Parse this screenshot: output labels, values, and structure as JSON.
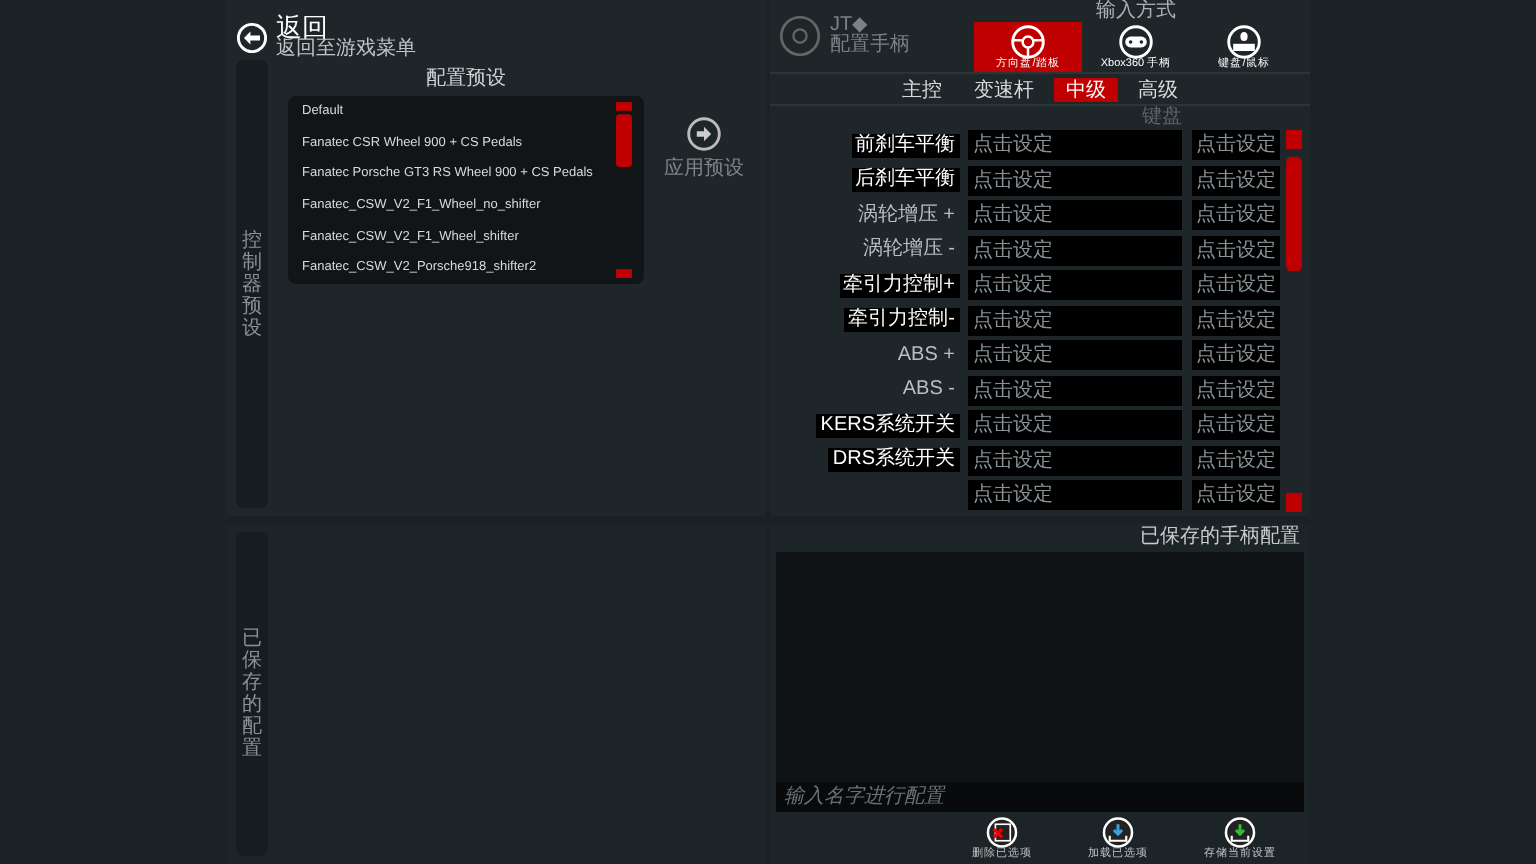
{
  "back": {
    "label": "返回",
    "subtitle": "返回至游戏菜单"
  },
  "presets": {
    "side_label": "控制器预设",
    "title": "配置预设",
    "items": [
      {
        "label": "Default",
        "selected": false
      },
      {
        "label": "Fanatec CSR Wheel 900 + CS Pedals",
        "selected": false
      },
      {
        "label": "Fanatec Porsche GT3 RS Wheel 900 + CS Pedals",
        "selected": false
      },
      {
        "label": "Fanatec_CSW_V2_F1_Wheel_no_shifter",
        "selected": false
      },
      {
        "label": "Fanatec_CSW_V2_F1_Wheel_shifter",
        "selected": false
      },
      {
        "label": "Fanatec_CSW_V2_Porsche918_shifter2",
        "selected": false
      }
    ],
    "apply_label": "应用预设"
  },
  "saved_side_label": "已保存的配置",
  "profile": {
    "title": "JT◆",
    "subtitle": "配置手柄"
  },
  "input_method": {
    "title": "输入方式",
    "tabs": [
      {
        "label": "方向盘/踏板",
        "kind": "wheel",
        "selected": true
      },
      {
        "label": "Xbox360 手柄",
        "kind": "gamepad",
        "selected": false
      },
      {
        "label": "键盘/鼠标",
        "kind": "keyboard",
        "selected": false
      }
    ]
  },
  "sub_tabs": [
    {
      "label": "主控",
      "selected": false
    },
    {
      "label": "变速杆",
      "selected": false
    },
    {
      "label": "中级",
      "selected": true
    },
    {
      "label": "高级",
      "selected": false
    }
  ],
  "bindings": {
    "column_2": "键盘",
    "rows": [
      {
        "label": "前刹车平衡",
        "highlighted": true,
        "primary": "点击设定",
        "secondary": "点击设定"
      },
      {
        "label": "后刹车平衡",
        "highlighted": true,
        "primary": "点击设定",
        "secondary": "点击设定"
      },
      {
        "label": "涡轮增压 +",
        "highlighted": false,
        "primary": "点击设定",
        "secondary": "点击设定"
      },
      {
        "label": "涡轮增压 -",
        "highlighted": false,
        "primary": "点击设定",
        "secondary": "点击设定"
      },
      {
        "label": "牵引力控制+",
        "highlighted": true,
        "primary": "点击设定",
        "secondary": "点击设定"
      },
      {
        "label": "牵引力控制-",
        "highlighted": true,
        "primary": "点击设定",
        "secondary": "点击设定"
      },
      {
        "label": "ABS +",
        "highlighted": false,
        "primary": "点击设定",
        "secondary": "点击设定"
      },
      {
        "label": "ABS -",
        "highlighted": false,
        "primary": "点击设定",
        "secondary": "点击设定"
      },
      {
        "label": "KERS系统开关",
        "highlighted": true,
        "primary": "点击设定",
        "secondary": "点击设定"
      },
      {
        "label": "DRS系统开关",
        "highlighted": true,
        "primary": "点击设定",
        "secondary": "点击设定"
      },
      {
        "primary": "点击设定",
        "secondary": "点击设定"
      }
    ]
  },
  "saved": {
    "title": "已保存的手柄配置",
    "placeholder": "输入名字进行配置",
    "actions": [
      {
        "label": "删除已选项",
        "kind": "delete"
      },
      {
        "label": "加载已选项",
        "kind": "load"
      },
      {
        "label": "存储当前设置",
        "kind": "save"
      }
    ]
  }
}
